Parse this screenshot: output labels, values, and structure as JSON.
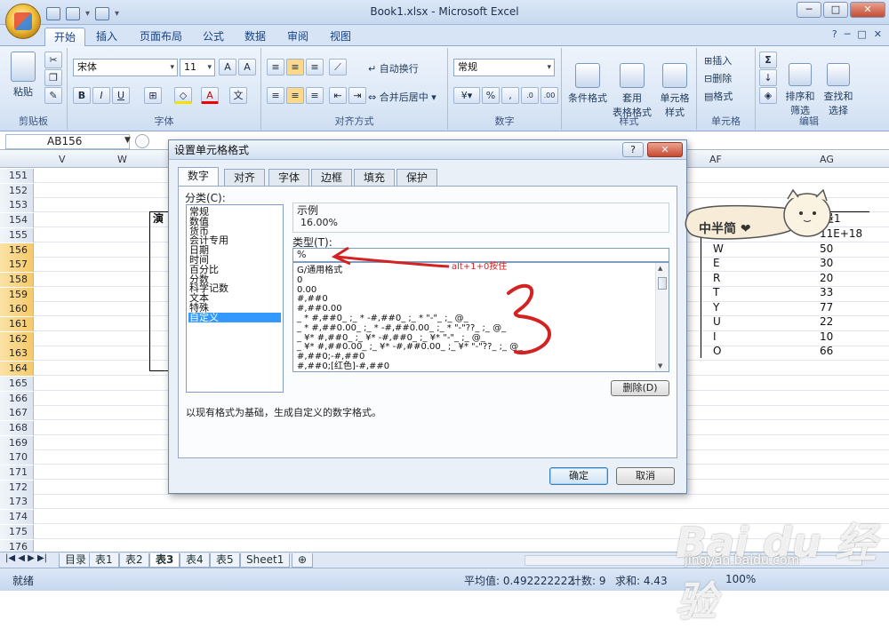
{
  "window": {
    "title": "Book1.xlsx - Microsoft Excel",
    "min": "─",
    "max": "□",
    "close": "✕"
  },
  "ribbon_tabs": [
    "开始",
    "插入",
    "页面布局",
    "公式",
    "数据",
    "审阅",
    "视图"
  ],
  "ribbon": {
    "paste": "粘贴",
    "font_name": "宋体",
    "font_size": "11",
    "number_format": "常规",
    "wrap_text": "自动换行",
    "merge_center": "合并后居中",
    "cond_format": "条件格式",
    "table_format": "套用\n表格格式",
    "cell_style": "单元格\n样式",
    "insert": "插入",
    "delete": "删除",
    "format": "格式",
    "sort_filter": "排序和\n筛选",
    "find_select": "查找和\n选择",
    "groups": {
      "clipboard": "剪贴板",
      "font": "字体",
      "alignment": "对齐方式",
      "number": "数字",
      "styles": "样式",
      "cells": "单元格",
      "editing": "编辑"
    }
  },
  "namebox": "AB156",
  "columns": {
    "left": [
      "V",
      "W"
    ],
    "right": [
      "AF",
      "AG"
    ]
  },
  "rows": [
    "151",
    "152",
    "153",
    "154",
    "155",
    "156",
    "157",
    "158",
    "159",
    "160",
    "161",
    "162",
    "163",
    "164",
    "165",
    "166",
    "167",
    "168",
    "169",
    "170",
    "171",
    "172",
    "173",
    "174",
    "175",
    "176"
  ],
  "cells": {
    "left_header": "演",
    "right_header": "量1",
    "af": [
      "E",
      "W",
      "E",
      "R",
      "T",
      "Y",
      "U",
      "I",
      "O"
    ],
    "ag": [
      "11E+18",
      "50",
      "30",
      "20",
      "33",
      "77",
      "22",
      "10",
      "66"
    ]
  },
  "dialog": {
    "title": "设置单元格格式",
    "help": "?",
    "close": "✕",
    "tabs": [
      "数字",
      "对齐",
      "字体",
      "边框",
      "填充",
      "保护"
    ],
    "category_label": "分类(C):",
    "categories": [
      "常规",
      "数值",
      "货币",
      "会计专用",
      "日期",
      "时间",
      "百分比",
      "分数",
      "科学记数",
      "文本",
      "特殊",
      "自定义"
    ],
    "sample_label": "示例",
    "sample_value": "16.00%",
    "type_label": "类型(T):",
    "type_value": "%",
    "formats": [
      "G/通用格式",
      "0",
      "0.00",
      "#,##0",
      "#,##0.00",
      "_ * #,##0_ ;_ * -#,##0_ ;_ * \"-\"_ ;_ @_",
      "_ * #,##0.00_ ;_ * -#,##0.00_ ;_ * \"-\"??_ ;_ @_",
      "_ ¥* #,##0_ ;_ ¥* -#,##0_ ;_ ¥* \"-\"_ ;_ @_",
      "_ ¥* #,##0.00_ ;_ ¥* -#,##0.00_ ;_ ¥* \"-\"??_ ;_ @_",
      "#,##0;-#,##0",
      "#,##0;[红色]-#,##0"
    ],
    "delete_btn": "删除(D)",
    "description": "以现有格式为基础，生成自定义的数字格式。",
    "ok": "确定",
    "cancel": "取消"
  },
  "annotation": {
    "text": "alt+1+0按住",
    "color": "#d22222"
  },
  "sticker": {
    "text": "中半简 ❤"
  },
  "sheet_tabs": [
    "目录",
    "表1",
    "表2",
    "表3",
    "表4",
    "表5",
    "Sheet1"
  ],
  "active_sheet": "表3",
  "status": {
    "ready": "就绪",
    "average": "平均值: 0.492222222",
    "count": "计数: 9",
    "sum": "求和: 4.43",
    "zoom": "100%"
  },
  "watermark": {
    "main": "Bai du 经验",
    "url": "jingyan.baidu.com"
  }
}
